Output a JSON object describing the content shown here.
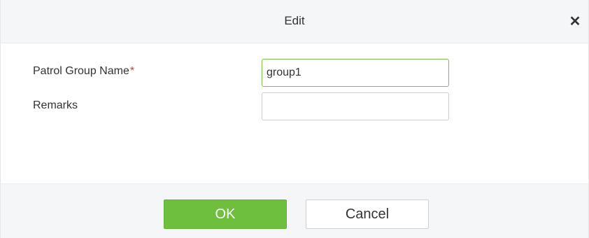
{
  "dialog": {
    "title": "Edit",
    "close_icon": "close-icon",
    "close_glyph": "✕"
  },
  "form": {
    "patrol_group_name": {
      "label": "Patrol Group Name",
      "required_mark": "*",
      "value": "group1"
    },
    "remarks": {
      "label": "Remarks",
      "value": ""
    }
  },
  "footer": {
    "ok_label": "OK",
    "cancel_label": "Cancel"
  },
  "colors": {
    "accent": "#6fbf3f",
    "required": "#e03535",
    "focus_border": "#7cc34a"
  }
}
